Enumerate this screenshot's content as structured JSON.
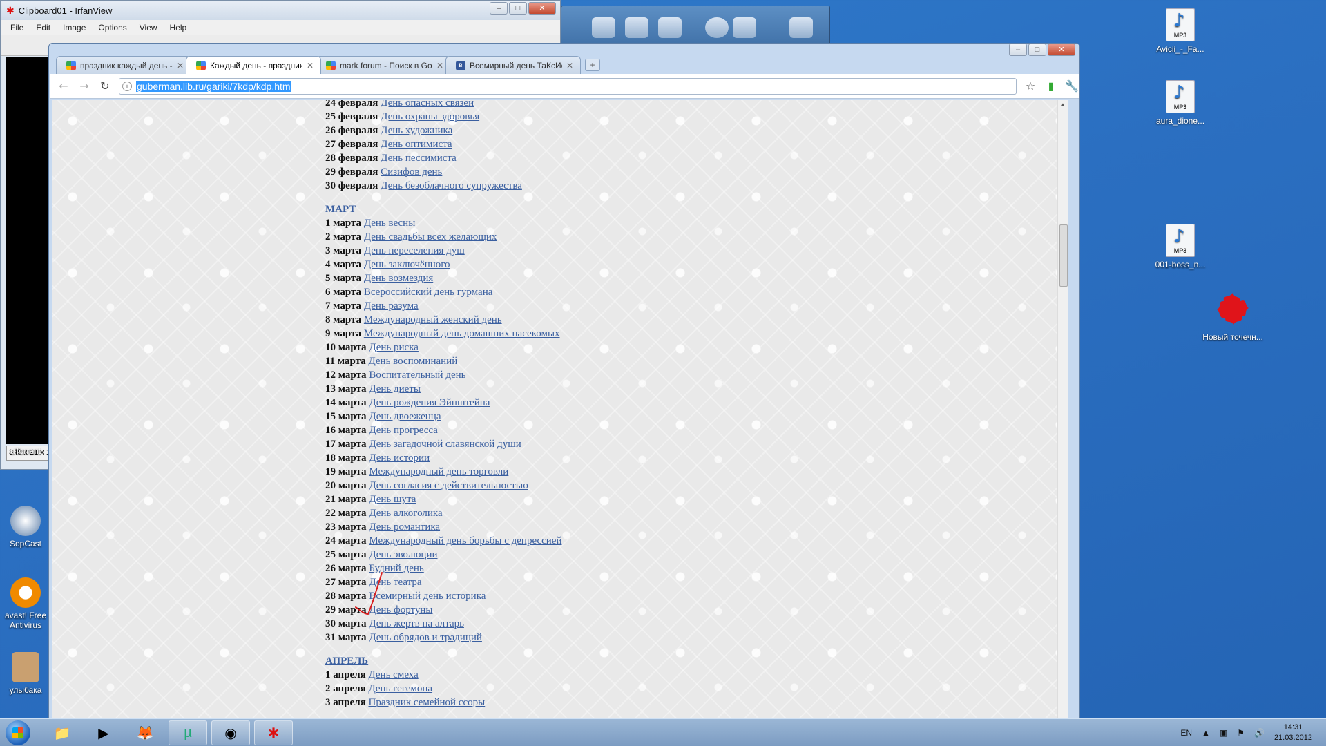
{
  "irfanview": {
    "title": "Clipboard01 - IrfanView",
    "menu": [
      "File",
      "Edit",
      "Image",
      "Options",
      "View",
      "Help"
    ],
    "status": "349 x 21 x 1"
  },
  "desktop_icons_left": [
    {
      "label": "uTorrent"
    },
    {
      "label": "SopCast"
    },
    {
      "label": "avast! Free Antivirus"
    },
    {
      "label": "улыбака"
    }
  ],
  "desktop_icons_right": [
    {
      "label": "Avicii_-_Fa..."
    },
    {
      "label": "aura_dione..."
    },
    {
      "label": "001-boss_n..."
    },
    {
      "label": "Новый точечн..."
    }
  ],
  "mp3_badge": "MP3",
  "browser": {
    "tabs": [
      {
        "label": "праздник каждый день - Г",
        "favicon": "google",
        "active": false
      },
      {
        "label": "Каждый день - праздник. |",
        "favicon": "google",
        "active": true
      },
      {
        "label": "mark forum - Поиск в Goo",
        "favicon": "google",
        "active": false
      },
      {
        "label": "Всемирный день ТаКсИсТ",
        "favicon": "vk",
        "active": false
      }
    ],
    "url": "guberman.lib.ru/gariki/7kdp/kdp.htm"
  },
  "page": {
    "feb": [
      {
        "date": "24 февраля",
        "name": "День опасных связей"
      },
      {
        "date": "25 февраля",
        "name": "День охраны здоровья"
      },
      {
        "date": "26 февраля",
        "name": "День художника"
      },
      {
        "date": "27 февраля",
        "name": "День оптимиста"
      },
      {
        "date": "28 февраля",
        "name": "День пессимиста"
      },
      {
        "date": "29 февраля",
        "name": "Сизифов день"
      },
      {
        "date": "30 февраля",
        "name": "День безоблачного супружества"
      }
    ],
    "march_heading": "МАРТ",
    "march": [
      {
        "date": "1 марта",
        "name": "День весны"
      },
      {
        "date": "2 марта",
        "name": "День свадьбы всех желающих"
      },
      {
        "date": "3 марта",
        "name": "День переселения душ"
      },
      {
        "date": "4 марта",
        "name": "День заключённого"
      },
      {
        "date": "5 марта",
        "name": "День возмездия"
      },
      {
        "date": "6 марта",
        "name": "Всероссийский день гурмана"
      },
      {
        "date": "7 марта",
        "name": "День разума"
      },
      {
        "date": "8 марта",
        "name": "Международный женский день"
      },
      {
        "date": "9 марта",
        "name": "Международный день домашних насекомых"
      },
      {
        "date": "10 марта",
        "name": "День риска"
      },
      {
        "date": "11 марта",
        "name": "День воспоминаний"
      },
      {
        "date": "12 марта",
        "name": "Воспитательный день"
      },
      {
        "date": "13 марта",
        "name": "День диеты"
      },
      {
        "date": "14 марта",
        "name": "День рождения Эйнштейна"
      },
      {
        "date": "15 марта",
        "name": "День двоеженца"
      },
      {
        "date": "16 марта",
        "name": "День прогресса"
      },
      {
        "date": "17 марта",
        "name": "День загадочной славянской души"
      },
      {
        "date": "18 марта",
        "name": "День истории"
      },
      {
        "date": "19 марта",
        "name": "Международный день торговли"
      },
      {
        "date": "20 марта",
        "name": "День согласия с действительностью"
      },
      {
        "date": "21 марта",
        "name": "День шута"
      },
      {
        "date": "22 марта",
        "name": "День алкоголика"
      },
      {
        "date": "23 марта",
        "name": "День романтика"
      },
      {
        "date": "24 марта",
        "name": "Международный день борьбы с депрессией"
      },
      {
        "date": "25 марта",
        "name": "День эволюции"
      },
      {
        "date": "26 марта",
        "name": "Будний день"
      },
      {
        "date": "27 марта",
        "name": "День театра"
      },
      {
        "date": "28 марта",
        "name": "Всемирный день историка"
      },
      {
        "date": "29 марта",
        "name": "День фортуны"
      },
      {
        "date": "30 марта",
        "name": "День жертв на алтарь"
      },
      {
        "date": "31 марта",
        "name": "День обрядов и традиций"
      }
    ],
    "april_heading": "АПРЕЛЬ",
    "april": [
      {
        "date": "1 апреля",
        "name": "День смеха"
      },
      {
        "date": "2 апреля",
        "name": "День гегемона"
      },
      {
        "date": "3 апреля",
        "name": "Праздник семейной ссоры"
      }
    ]
  },
  "taskbar": {
    "language": "EN",
    "time": "14:31",
    "date": "21.03.2012"
  },
  "colors": {
    "link": "#3a5fa0",
    "url_highlight": "#3399ff",
    "desktop": "#2b6fc1"
  }
}
